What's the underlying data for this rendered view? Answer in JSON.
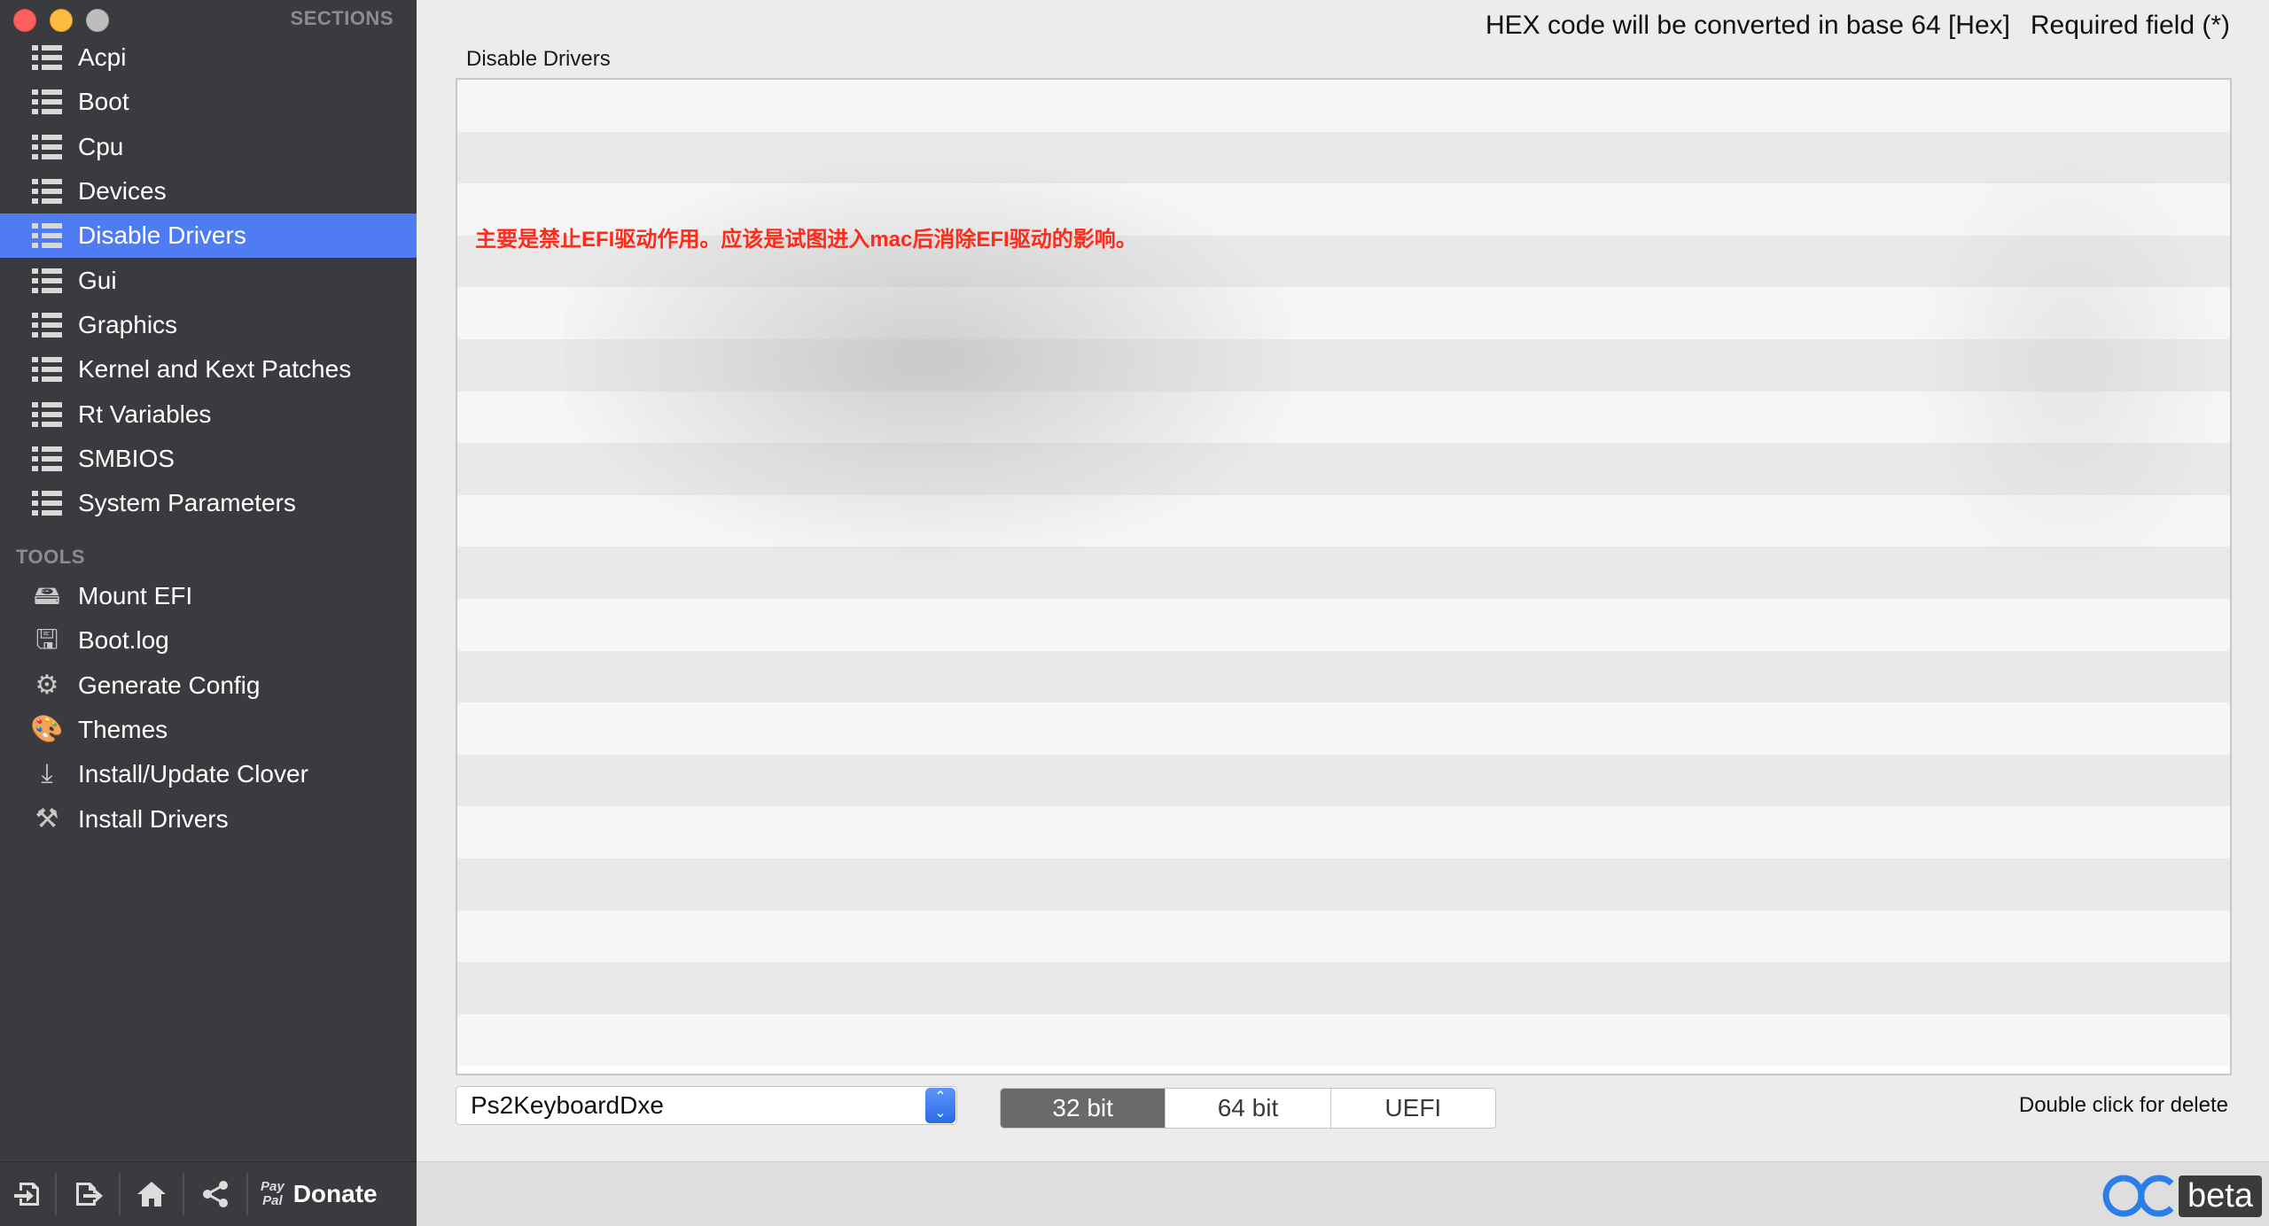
{
  "window": {
    "buttons": [
      "close",
      "minimize",
      "maximize"
    ]
  },
  "sidebar": {
    "sections_header": "SECTIONS",
    "sections": [
      {
        "label": "Acpi",
        "icon": "list-icon"
      },
      {
        "label": "Boot",
        "icon": "list-icon"
      },
      {
        "label": "Cpu",
        "icon": "list-icon"
      },
      {
        "label": "Devices",
        "icon": "list-icon"
      },
      {
        "label": "Disable Drivers",
        "icon": "list-icon",
        "active": true
      },
      {
        "label": "Gui",
        "icon": "list-icon"
      },
      {
        "label": "Graphics",
        "icon": "list-icon"
      },
      {
        "label": "Kernel and Kext Patches",
        "icon": "list-icon"
      },
      {
        "label": "Rt Variables",
        "icon": "list-icon"
      },
      {
        "label": "SMBIOS",
        "icon": "list-icon"
      },
      {
        "label": "System Parameters",
        "icon": "list-icon"
      }
    ],
    "tools_header": "TOOLS",
    "tools": [
      {
        "label": "Mount EFI",
        "icon": "mount-efi-icon"
      },
      {
        "label": "Boot.log",
        "icon": "boot-log-icon"
      },
      {
        "label": "Generate Config",
        "icon": "gears-icon"
      },
      {
        "label": "Themes",
        "icon": "palette-icon"
      },
      {
        "label": "Install/Update Clover",
        "icon": "download-icon"
      },
      {
        "label": "Install Drivers",
        "icon": "tools-icon"
      }
    ],
    "bottom_bar": {
      "paypal_mark_top": "Pay",
      "paypal_mark_bottom": "Pal",
      "donate_label": "Donate",
      "buttons": [
        "import-icon",
        "export-icon",
        "home-icon",
        "share-icon"
      ]
    }
  },
  "main": {
    "hex_note": "HEX code will be converted in base 64 [Hex]",
    "required_note": "Required field (*)",
    "panel_title": "Disable Drivers",
    "annotation": "主要是禁止EFI驱动作用。应该是试图进入mac后消除EFI驱动的影响。",
    "table_rows": 19,
    "driver_select": {
      "value": "Ps2KeyboardDxe"
    },
    "arch_segment": {
      "options": [
        "32 bit",
        "64 bit",
        "UEFI"
      ],
      "selected": "32 bit"
    },
    "delete_hint": "Double click for delete",
    "logo_text": "beta"
  },
  "colors": {
    "sidebar_bg": "#3a3b3e",
    "active_item": "#4f7cf2",
    "annotation": "#ff2a1a",
    "accent_logo": "#2a7ee8"
  }
}
